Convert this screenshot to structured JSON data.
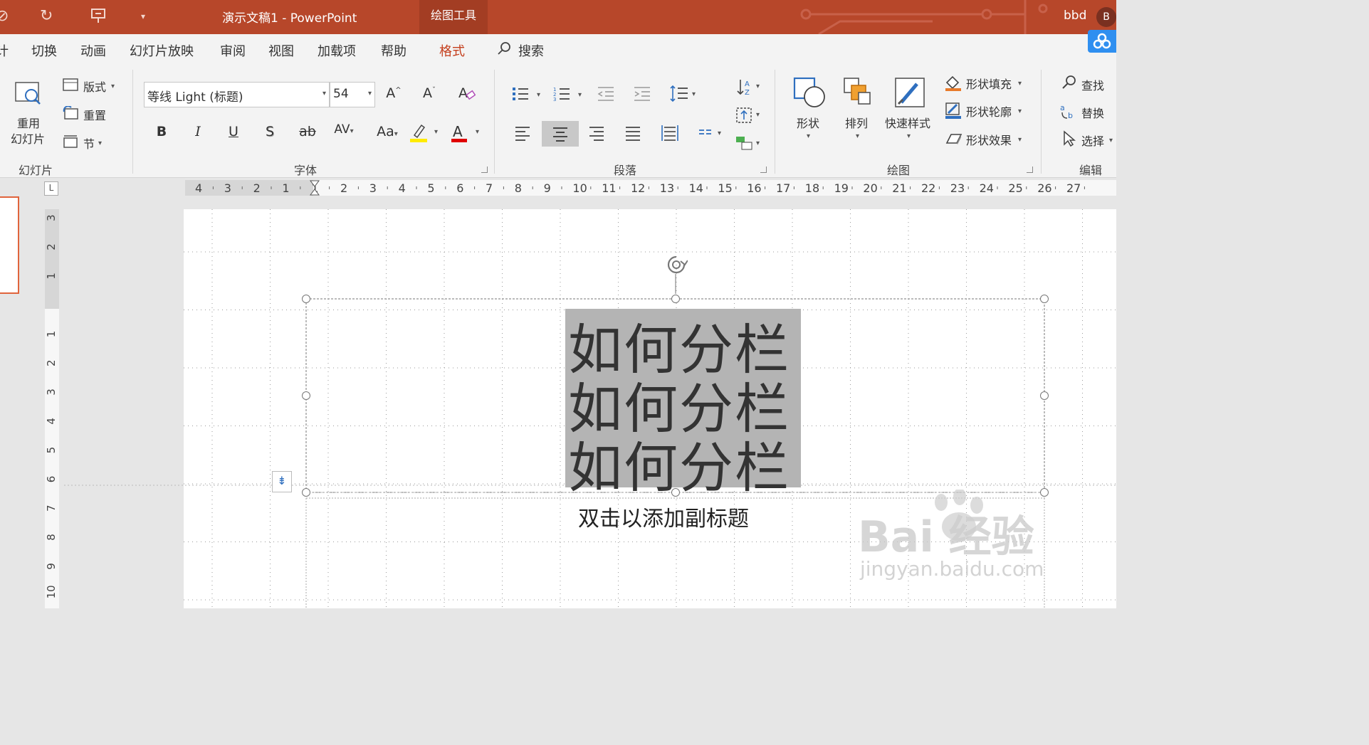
{
  "titlebar": {
    "doc_title": "演示文稿1  -  PowerPoint",
    "context_tab": "绘图工具",
    "user_name": "bbd",
    "avatar_letter": "B"
  },
  "tabs": [
    {
      "label": "计",
      "active": false
    },
    {
      "label": "切换",
      "active": false
    },
    {
      "label": "动画",
      "active": false
    },
    {
      "label": "幻灯片放映",
      "active": false
    },
    {
      "label": "审阅",
      "active": false
    },
    {
      "label": "视图",
      "active": false
    },
    {
      "label": "加载项",
      "active": false
    },
    {
      "label": "帮助",
      "active": false
    },
    {
      "label": "格式",
      "active": true
    }
  ],
  "search_label": "搜索",
  "ribbon": {
    "slides_group": {
      "reuse_line1": "重用",
      "reuse_line2": "幻灯片",
      "layout": "版式",
      "reset": "重置",
      "section": "节",
      "label": "幻灯片"
    },
    "font_group": {
      "font_name": "等线 Light (标题)",
      "font_size": "54",
      "bold": "B",
      "italic": "I",
      "underline": "U",
      "shadow": "S",
      "strike": "ab",
      "spacing": "AV",
      "case": "Aa",
      "font_color_letter": "A",
      "grow": "A",
      "shrink": "A",
      "label": "字体"
    },
    "paragraph_group": {
      "label": "段落"
    },
    "drawing_group": {
      "shape": "形状",
      "arrange": "排列",
      "quick_style": "快速样式",
      "shape_fill": "形状填充",
      "shape_outline": "形状轮廓",
      "shape_effects": "形状效果",
      "label": "绘图"
    },
    "editing_group": {
      "find": "查找",
      "replace": "替换",
      "select": "选择",
      "label": "编辑"
    }
  },
  "ruler": {
    "horizontal": [
      "4",
      "3",
      "2",
      "1",
      "1",
      "2",
      "3",
      "4",
      "5",
      "6",
      "7",
      "8",
      "9",
      "10",
      "11",
      "12",
      "13",
      "14",
      "15",
      "16",
      "17",
      "18",
      "19",
      "20",
      "21",
      "22",
      "23",
      "24",
      "25",
      "26",
      "27"
    ],
    "vertical": [
      "3",
      "2",
      "1",
      "1",
      "2",
      "3",
      "4",
      "5",
      "6",
      "7",
      "8",
      "9",
      "10"
    ],
    "corner": "L"
  },
  "slide": {
    "title_lines": [
      "如何分栏",
      "如何分栏",
      "如何分栏"
    ],
    "subtitle_placeholder": "双击以添加副标题"
  },
  "watermark": {
    "brand": "Bai  经验",
    "url": "jingyan.baidu.com"
  },
  "colors": {
    "titlebar": "#b7472a",
    "accent": "#c43e1c",
    "selection": "#b4b4b4"
  }
}
